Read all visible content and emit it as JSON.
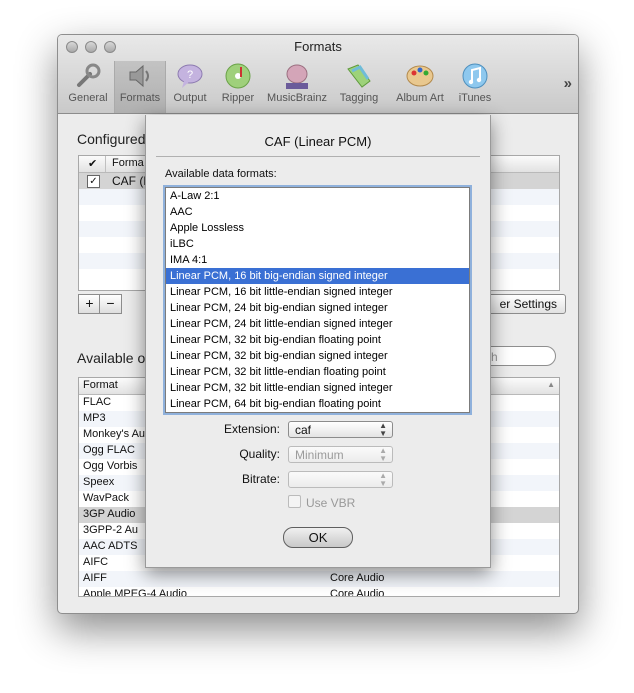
{
  "window": {
    "title": "Formats",
    "toolbar": [
      {
        "label": "General",
        "icon": "wrench-icon",
        "selected": false
      },
      {
        "label": "Formats",
        "icon": "speaker-icon",
        "selected": true
      },
      {
        "label": "Output",
        "icon": "speech-bubble-icon",
        "selected": false
      },
      {
        "label": "Ripper",
        "icon": "music-disc-icon",
        "selected": false
      },
      {
        "label": "MusicBrainz",
        "icon": "musicbrainz-icon",
        "selected": false
      },
      {
        "label": "Tagging",
        "icon": "tags-icon",
        "selected": false
      },
      {
        "label": "Album Art",
        "icon": "palette-icon",
        "selected": false
      },
      {
        "label": "iTunes",
        "icon": "itunes-icon",
        "selected": false
      }
    ],
    "overflow_glyph": "»"
  },
  "configured": {
    "heading": "Configured",
    "column_check": "✔",
    "column_format": "Forma",
    "row_check": "✓",
    "row_label": "CAF (L"
  },
  "buttons": {
    "add": "+",
    "remove": "−",
    "settings_partial": "er Settings"
  },
  "available": {
    "heading": "Available o",
    "search_partial": "rch",
    "column_format": "Format",
    "sort_glyph": "▲",
    "rows": [
      {
        "name": "FLAC",
        "encoder": ""
      },
      {
        "name": "MP3",
        "encoder": ""
      },
      {
        "name": "Monkey's Au",
        "encoder": ""
      },
      {
        "name": "Ogg FLAC",
        "encoder": ""
      },
      {
        "name": "Ogg Vorbis",
        "encoder": ""
      },
      {
        "name": "Speex",
        "encoder": ""
      },
      {
        "name": "WavPack",
        "encoder": ""
      },
      {
        "name": "3GP Audio",
        "encoder": ""
      },
      {
        "name": "3GPP-2 Au",
        "encoder": ""
      },
      {
        "name": "AAC ADTS",
        "encoder": ""
      },
      {
        "name": "AIFC",
        "encoder": ""
      },
      {
        "name": "AIFF",
        "encoder": "Core Audio"
      },
      {
        "name": "Apple MPEG-4 Audio",
        "encoder": "Core Audio"
      }
    ]
  },
  "sheet": {
    "title": "CAF (Linear PCM)",
    "list_label": "Available data formats:",
    "formats": [
      "A-Law 2:1",
      "AAC",
      "Apple Lossless",
      "iLBC",
      "IMA 4:1",
      "Linear PCM, 16 bit big-endian signed integer",
      "Linear PCM, 16 bit little-endian signed integer",
      "Linear PCM, 24 bit big-endian signed integer",
      "Linear PCM, 24 bit little-endian signed integer",
      "Linear PCM, 32 bit big-endian floating point",
      "Linear PCM, 32 bit big-endian signed integer",
      "Linear PCM, 32 bit little-endian floating point",
      "Linear PCM, 32 bit little-endian signed integer",
      "Linear PCM, 64 bit big-endian floating point"
    ],
    "selected_format": "Linear PCM, 16 bit big-endian signed integer",
    "extension_label": "Extension:",
    "extension_value": "caf",
    "quality_label": "Quality:",
    "quality_value": "Minimum",
    "bitrate_label": "Bitrate:",
    "bitrate_value": "",
    "vbr_label": "Use VBR",
    "ok_label": "OK"
  }
}
